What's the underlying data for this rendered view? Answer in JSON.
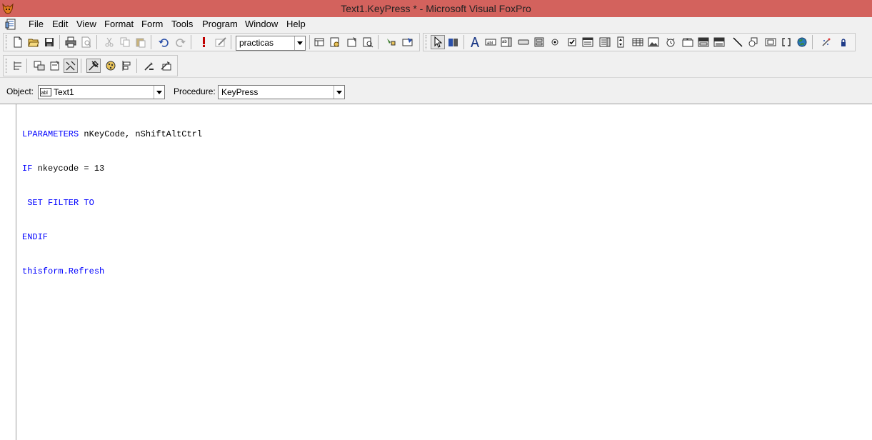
{
  "window": {
    "title": "Text1.KeyPress * - Microsoft Visual FoxPro",
    "titlebar_color": "#d3625d"
  },
  "menu": {
    "items": [
      {
        "id": "file",
        "label": "File"
      },
      {
        "id": "edit",
        "label": "Edit"
      },
      {
        "id": "view",
        "label": "View"
      },
      {
        "id": "format",
        "label": "Format"
      },
      {
        "id": "form",
        "label": "Form"
      },
      {
        "id": "tools",
        "label": "Tools"
      },
      {
        "id": "program",
        "label": "Program"
      },
      {
        "id": "window",
        "label": "Window"
      },
      {
        "id": "help",
        "label": "Help"
      }
    ]
  },
  "toolbar": {
    "project_combo": {
      "value": "practicas"
    },
    "standard_icons": [
      "new-file-icon",
      "open-folder-icon",
      "save-icon",
      "print-icon",
      "print-preview-icon",
      "cut-icon",
      "copy-icon",
      "paste-icon",
      "undo-icon",
      "redo-icon",
      "run-icon",
      "modify-form-icon"
    ],
    "data_icons": [
      "data-environment-icon",
      "properties-window-icon",
      "code-window-icon",
      "form-control-toolbar-icon",
      "builder-icon",
      "autoformat-icon"
    ],
    "controls_icons": [
      "select-objects-icon",
      "view-classes-icon",
      "label-icon",
      "textbox-icon",
      "editbox-icon",
      "command-button-icon",
      "command-group-icon",
      "option-group-icon",
      "checkbox-icon",
      "combobox-icon",
      "listbox-icon",
      "spinner-icon",
      "grid-icon",
      "image-icon",
      "timer-icon",
      "pageframe-icon",
      "olecontrol-icon",
      "oleboundcontrol-icon",
      "line-icon",
      "shape-icon",
      "container-icon",
      "separator-icon",
      "hyperlink-icon",
      "builder-lock-icon",
      "lock-icon"
    ],
    "layout_icons": [
      "layout-icon",
      "form-designer-icon",
      "properties-icon",
      "data-builder-icon",
      "tools-icon",
      "color-palette-icon",
      "layout-align-icon",
      "wizard-icon",
      "autoformat-builder-icon"
    ]
  },
  "object_bar": {
    "object_label": "Object:",
    "object_value": "Text1",
    "procedure_label": "Procedure:",
    "procedure_value": "KeyPress"
  },
  "code": {
    "line1": {
      "kw": "LPARAMETERS",
      "rest": " nKeyCode, nShiftAltCtrl"
    },
    "line2": {
      "kw": "IF",
      "rest": " nkeycode = 13"
    },
    "line3": {
      "kw": " SET FILTER TO",
      "rest": ""
    },
    "line4": {
      "kw": "ENDIF",
      "rest": ""
    },
    "line5": {
      "kw": "thisform.Refresh",
      "rest": ""
    }
  },
  "colors": {
    "keyword": "#0000ff",
    "toolbar_bg": "#f0f0f0"
  }
}
